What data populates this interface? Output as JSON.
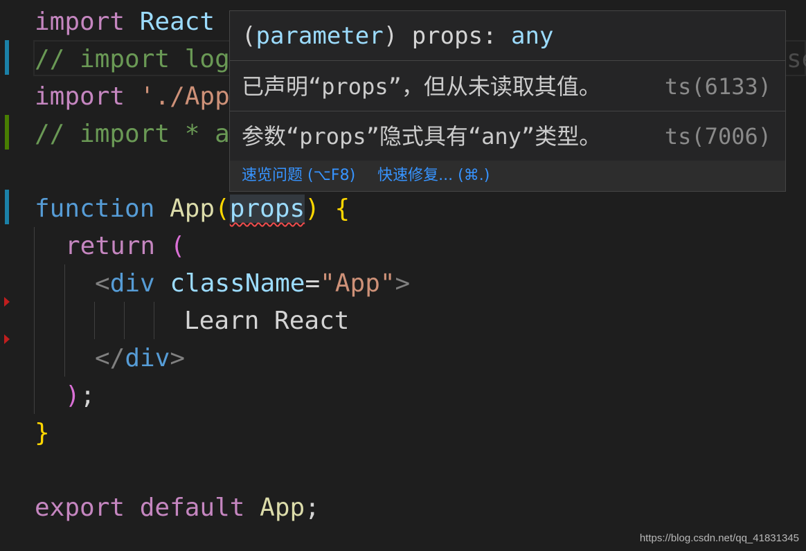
{
  "code": {
    "l1": {
      "kw": "import",
      "name": "React"
    },
    "l2": {
      "comment": "// import log"
    },
    "l3": {
      "kw": "import",
      "str": "'./App"
    },
    "l4": {
      "comment": "// import * a"
    },
    "l6": {
      "kw": "function",
      "name": "App",
      "paren_open": "(",
      "param": "props",
      "paren_close": ")",
      "brace": "{"
    },
    "l7": {
      "kw": "return",
      "paren": "("
    },
    "l8": {
      "lt": "<",
      "tag": "div",
      "attr": "className",
      "eq": "=",
      "val": "\"App\"",
      "gt": ">"
    },
    "l9": {
      "text": "Learn React"
    },
    "l10": {
      "lt": "</",
      "tag": "div",
      "gt": ">"
    },
    "l11": {
      "paren": ")",
      "semi": ";"
    },
    "l12": {
      "brace": "}"
    },
    "l14": {
      "kw1": "export",
      "kw2": "default",
      "name": "App",
      "semi": ";"
    },
    "hidden_tail": "se"
  },
  "hover": {
    "sig_paren_open": "(",
    "sig_kind": "parameter",
    "sig_paren_close": ")",
    "sig_name": "props",
    "sig_colon": ":",
    "sig_type": "any",
    "messages": [
      {
        "text": "已声明“props”，但从未读取其值。",
        "code": "ts(6133)"
      },
      {
        "text": "参数“props”隐式具有“any”类型。",
        "code": "ts(7006)"
      }
    ],
    "actions": [
      {
        "label": "速览问题 (⌥F8)"
      },
      {
        "label": "快速修复... (⌘.)"
      }
    ]
  },
  "watermark": "https://blog.csdn.net/qq_41831345",
  "colors": {
    "background": "#1e1e1e",
    "keyword_pink": "#c586c0",
    "keyword_blue": "#569cd6",
    "string": "#ce9178",
    "comment": "#6a9955",
    "link": "#3794ff",
    "error": "#f14c4c"
  }
}
